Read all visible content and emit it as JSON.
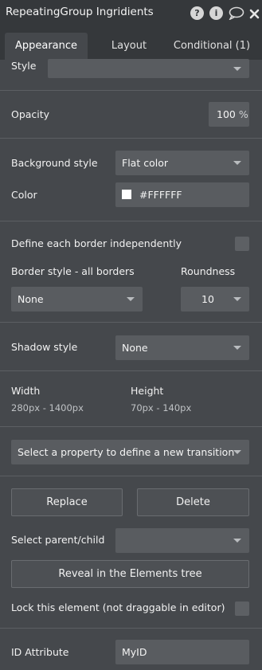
{
  "header": {
    "title": "RepeatingGroup Ingridients"
  },
  "tabs": [
    "Appearance",
    "Layout",
    "Conditional (1)"
  ],
  "style": {
    "label": "Style",
    "value": ""
  },
  "opacity": {
    "label": "Opacity",
    "value": "100",
    "unit": "%"
  },
  "background": {
    "label": "Background style",
    "value": "Flat color"
  },
  "color": {
    "label": "Color",
    "value": "#FFFFFF",
    "swatch": "#FFFFFF"
  },
  "border": {
    "independent_label": "Define each border independently",
    "style_label": "Border style - all borders",
    "style_value": "None",
    "roundness_label": "Roundness",
    "roundness_value": "10"
  },
  "shadow": {
    "label": "Shadow style",
    "value": "None"
  },
  "size": {
    "width_label": "Width",
    "width_value": "280px - 1400px",
    "height_label": "Height",
    "height_value": "70px - 140px"
  },
  "transition": {
    "placeholder": "Select a property to define a new transition"
  },
  "actions": {
    "replace": "Replace",
    "delete": "Delete",
    "select_parent_label": "Select parent/child",
    "select_parent_value": "",
    "reveal": "Reveal in the Elements tree",
    "lock_label": "Lock this element (not draggable in editor)"
  },
  "id_attribute": {
    "label": "ID Attribute",
    "value": "MyID"
  },
  "icons": [
    "help-icon",
    "info-icon",
    "comment-icon",
    "close-icon"
  ]
}
